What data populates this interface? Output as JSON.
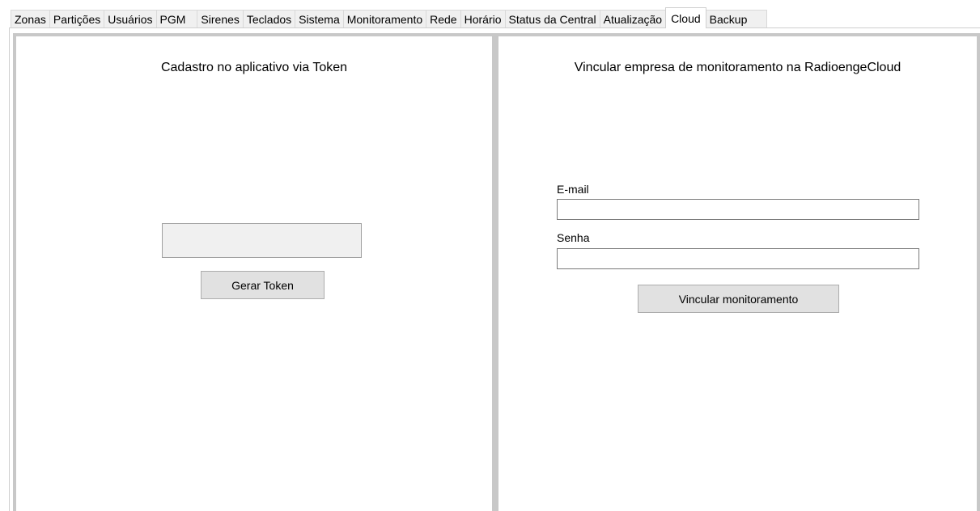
{
  "tabs": [
    {
      "label": "Zonas",
      "active": false
    },
    {
      "label": "Partições",
      "active": false
    },
    {
      "label": "Usuários",
      "active": false
    },
    {
      "label": "PGM",
      "active": false
    },
    {
      "label": "Sirenes",
      "active": false
    },
    {
      "label": "Teclados",
      "active": false
    },
    {
      "label": "Sistema",
      "active": false
    },
    {
      "label": "Monitoramento",
      "active": false
    },
    {
      "label": "Rede",
      "active": false
    },
    {
      "label": "Horário",
      "active": false
    },
    {
      "label": "Status da Central",
      "active": false
    },
    {
      "label": "Atualização",
      "active": false
    },
    {
      "label": "Cloud",
      "active": true
    },
    {
      "label": "Backup",
      "active": false
    }
  ],
  "token_panel": {
    "title": "Cadastro no aplicativo via Token",
    "token_value": "",
    "generate_button_label": "Gerar Token"
  },
  "cloud_panel": {
    "title": "Vincular empresa de monitoramento na RadioengeCloud",
    "email_label": "E-mail",
    "email_value": "",
    "password_label": "Senha",
    "password_value": "",
    "link_button_label": "Vincular monitoramento"
  }
}
